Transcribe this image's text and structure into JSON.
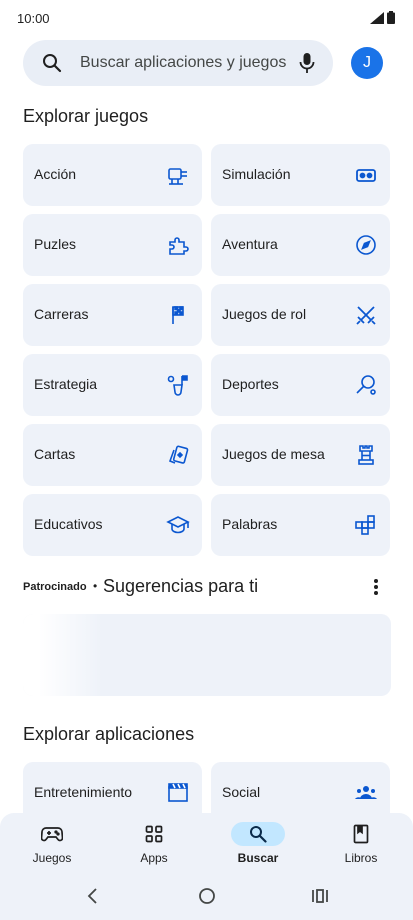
{
  "status_bar": {
    "time": "10:00"
  },
  "search": {
    "placeholder": "Buscar aplicaciones y juegos"
  },
  "account": {
    "initial": "J"
  },
  "games_section": {
    "title": "Explorar juegos",
    "categories": [
      {
        "label": "Acción",
        "icon": "action-icon"
      },
      {
        "label": "Simulación",
        "icon": "vr-headset-icon"
      },
      {
        "label": "Puzles",
        "icon": "puzzle-icon"
      },
      {
        "label": "Aventura",
        "icon": "compass-icon"
      },
      {
        "label": "Carreras",
        "icon": "checkered-flag-icon"
      },
      {
        "label": "Juegos de rol",
        "icon": "crossed-swords-icon"
      },
      {
        "label": "Estrategia",
        "icon": "strategy-icon"
      },
      {
        "label": "Deportes",
        "icon": "sports-icon"
      },
      {
        "label": "Cartas",
        "icon": "cards-icon"
      },
      {
        "label": "Juegos de mesa",
        "icon": "chess-rook-icon"
      },
      {
        "label": "Educativos",
        "icon": "graduation-cap-icon"
      },
      {
        "label": "Palabras",
        "icon": "word-tiles-icon"
      }
    ]
  },
  "sponsored": {
    "tag": "Patrocinado",
    "separator": "•",
    "title": "Sugerencias para ti"
  },
  "apps_section": {
    "title": "Explorar aplicaciones",
    "categories": [
      {
        "label": "Entretenimiento",
        "icon": "clapperboard-icon"
      },
      {
        "label": "Social",
        "icon": "people-icon"
      }
    ]
  },
  "bottom_nav": {
    "items": [
      {
        "label": "Juegos",
        "icon": "gamepad-icon",
        "active": false
      },
      {
        "label": "Apps",
        "icon": "apps-grid-icon",
        "active": false
      },
      {
        "label": "Buscar",
        "icon": "search-icon",
        "active": true
      },
      {
        "label": "Libros",
        "icon": "book-icon",
        "active": false
      }
    ]
  },
  "colors": {
    "accent": "#1a73e8",
    "icon_blue": "#0b57d0",
    "tile_bg": "#eef2f9",
    "active_pill": "#c2e7ff"
  }
}
